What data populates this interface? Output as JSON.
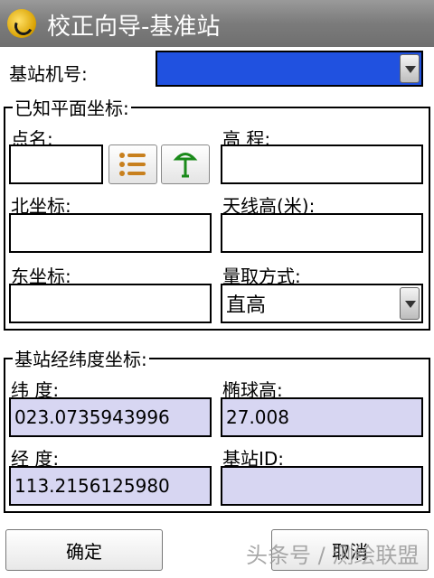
{
  "window": {
    "title": "校正向导-基准站",
    "icon": "app-logo-icon"
  },
  "station_id": {
    "label": "基站机号:",
    "selected_value": ""
  },
  "known_plane": {
    "group_title": "已知平面坐标:",
    "point_name": {
      "label": "点名:",
      "value": ""
    },
    "elevation": {
      "label": "高 程:",
      "value": ""
    },
    "north": {
      "label": "北坐标:",
      "value": ""
    },
    "antenna_height": {
      "label": "天线高(米):",
      "value": ""
    },
    "east": {
      "label": "东坐标:",
      "value": ""
    },
    "measure_method": {
      "label": "量取方式:",
      "selected_value": "直高"
    },
    "icons": {
      "list": "list-icon",
      "antenna": "antenna-icon"
    }
  },
  "lat_lon": {
    "group_title": "基站经纬度坐标:",
    "latitude": {
      "label": "纬 度:",
      "value": "023.0735943996"
    },
    "ellipsoid_height": {
      "label": "椭球高:",
      "value": "27.008"
    },
    "longitude": {
      "label": "经 度:",
      "value": "113.2156125980"
    },
    "base_id": {
      "label": "基站ID:",
      "value": ""
    }
  },
  "buttons": {
    "ok": "确定",
    "cancel": "取消"
  },
  "watermark": "头条号 / 测绘联盟",
  "colors": {
    "title_bar": "#7b7b7b",
    "selection_blue": "#2051e0",
    "readonly_fill": "#d7d6f2"
  }
}
